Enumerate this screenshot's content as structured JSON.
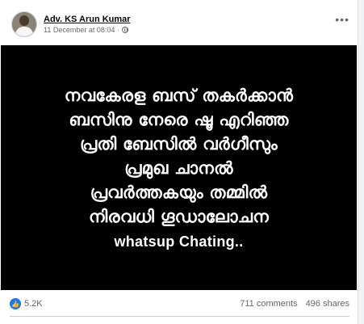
{
  "post": {
    "author": "Adv. KS Arun Kumar",
    "timestamp": "11 December at 08:04",
    "privacy_icon": "globe-icon",
    "more_icon": "more-options-icon",
    "image_text": {
      "line1": "നവകേരള ബസ് തകർക്കാൻ",
      "line2": "ബസിനു നേരെ ഷൂ എറിഞ്ഞ",
      "line3": "പ്രതി ബേസിൽ വർഗീസും",
      "line4": "പ്രമുഖ ചാനൽ",
      "line5": "പ്രവർത്തകയും തമ്മിൽ",
      "line6": "നിരവധി ഗൂഡാലോചന",
      "line7": "whatsup Chating.."
    }
  },
  "stats": {
    "reaction_icon": "like-icon",
    "reactions": "5.2K",
    "comments": "711 comments",
    "shares": "496 shares"
  },
  "colors": {
    "accent": "#1877f2",
    "image_background": "#000000",
    "secondary_text": "#65676b"
  }
}
